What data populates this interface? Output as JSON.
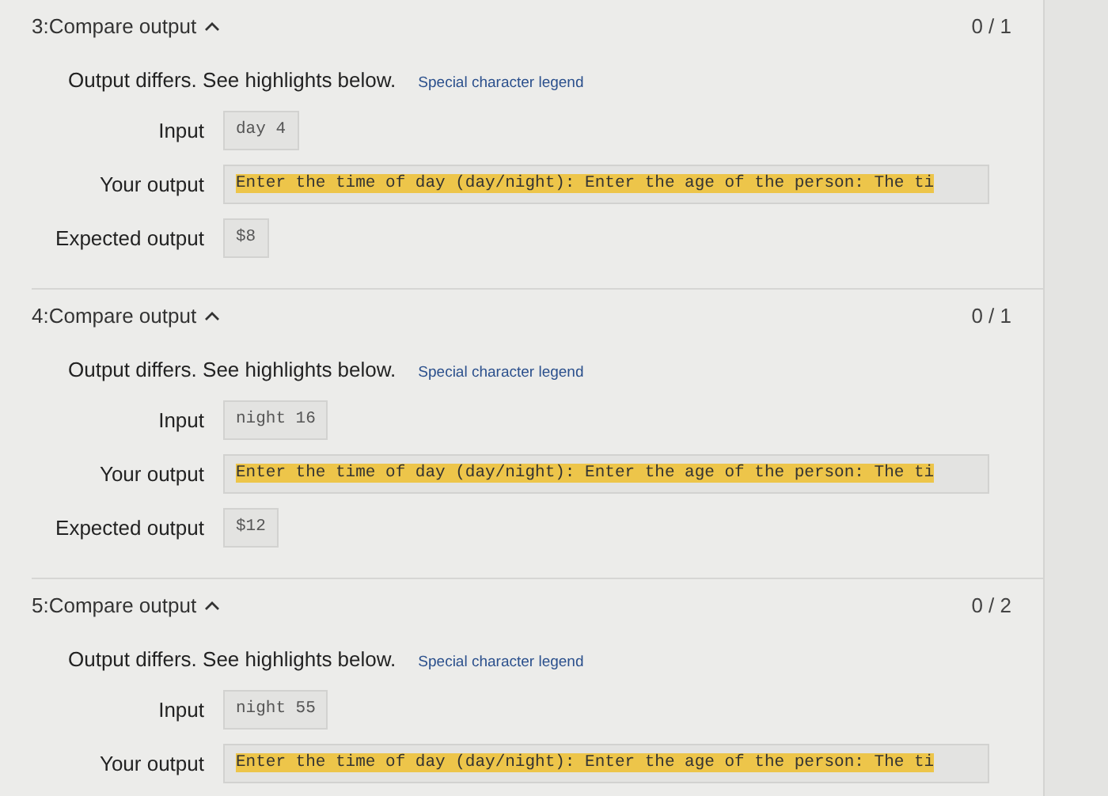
{
  "tests": [
    {
      "title": "3:Compare output",
      "expanded": true,
      "score": "0 / 1",
      "message": "Output differs. See highlights below.",
      "legend_link": "Special character legend",
      "rows": [
        {
          "label": "Input",
          "value": "day 4",
          "kind": "plain"
        },
        {
          "label": "Your output",
          "value": "Enter the time of day (day/night): Enter the age of the person: The ti",
          "kind": "highlighted"
        },
        {
          "label": "Expected output",
          "value": "$8",
          "kind": "plain"
        }
      ]
    },
    {
      "title": "4:Compare output",
      "expanded": true,
      "score": "0 / 1",
      "message": "Output differs. See highlights below.",
      "legend_link": "Special character legend",
      "rows": [
        {
          "label": "Input",
          "value": "night 16",
          "kind": "plain"
        },
        {
          "label": "Your output",
          "value": "Enter the time of day (day/night): Enter the age of the person: The ti",
          "kind": "highlighted"
        },
        {
          "label": "Expected output",
          "value": "$12",
          "kind": "plain"
        }
      ]
    },
    {
      "title": "5:Compare output",
      "expanded": true,
      "score": "0 / 2",
      "message": "Output differs. See highlights below.",
      "legend_link": "Special character legend",
      "rows": [
        {
          "label": "Input",
          "value": "night 55",
          "kind": "plain"
        },
        {
          "label": "Your output",
          "value": "Enter the time of day (day/night): Enter the age of the person: The ti",
          "kind": "highlighted"
        }
      ]
    }
  ]
}
